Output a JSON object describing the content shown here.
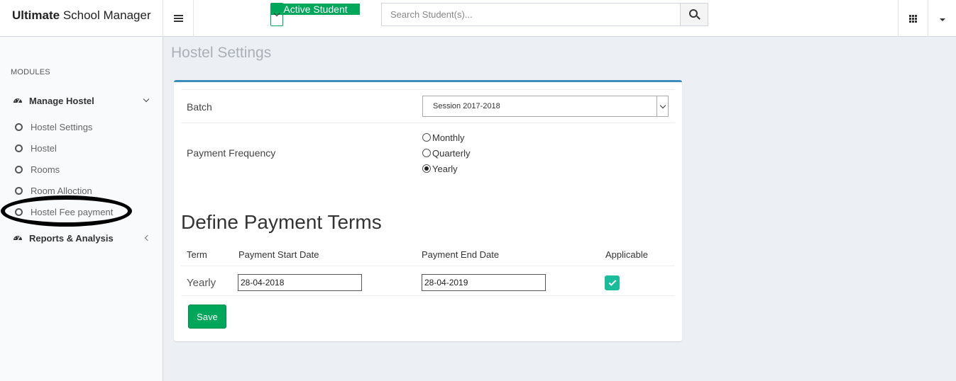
{
  "header": {
    "brand_bold": "Ultimate",
    "brand_rest": "School Manager",
    "active_student_label": "Active Student",
    "search_placeholder": "Search Student(s)..."
  },
  "sidebar": {
    "section_label": "MODULES",
    "groups": [
      {
        "label": "Manage Hostel",
        "icon": "dashboard-icon",
        "expanded": true,
        "items": [
          {
            "label": "Hostel Settings"
          },
          {
            "label": "Hostel"
          },
          {
            "label": "Rooms"
          },
          {
            "label": "Room Alloction"
          },
          {
            "label": "Hostel Fee payment",
            "annotated": true
          }
        ]
      },
      {
        "label": "Reports & Analysis",
        "icon": "dashboard-icon",
        "expanded": false
      }
    ]
  },
  "page": {
    "title": "Hostel Settings",
    "batch_label": "Batch",
    "batch_value": "Session 2017-2018",
    "payment_frequency_label": "Payment Frequency",
    "frequency_options": [
      {
        "label": "Monthly",
        "selected": false
      },
      {
        "label": "Quarterly",
        "selected": false
      },
      {
        "label": "Yearly",
        "selected": true
      }
    ],
    "section_title": "Define Payment Terms",
    "table": {
      "headers": [
        "Term",
        "Payment Start Date",
        "Payment End Date",
        "Applicable"
      ],
      "rows": [
        {
          "term": "Yearly",
          "start": "28-04-2018",
          "end": "28-04-2019",
          "applicable": true
        }
      ]
    },
    "save_label": "Save"
  },
  "colors": {
    "accent_green": "#00a65a",
    "box_top_border": "#3c8dbc",
    "checkbox_teal": "#1abc9c"
  }
}
